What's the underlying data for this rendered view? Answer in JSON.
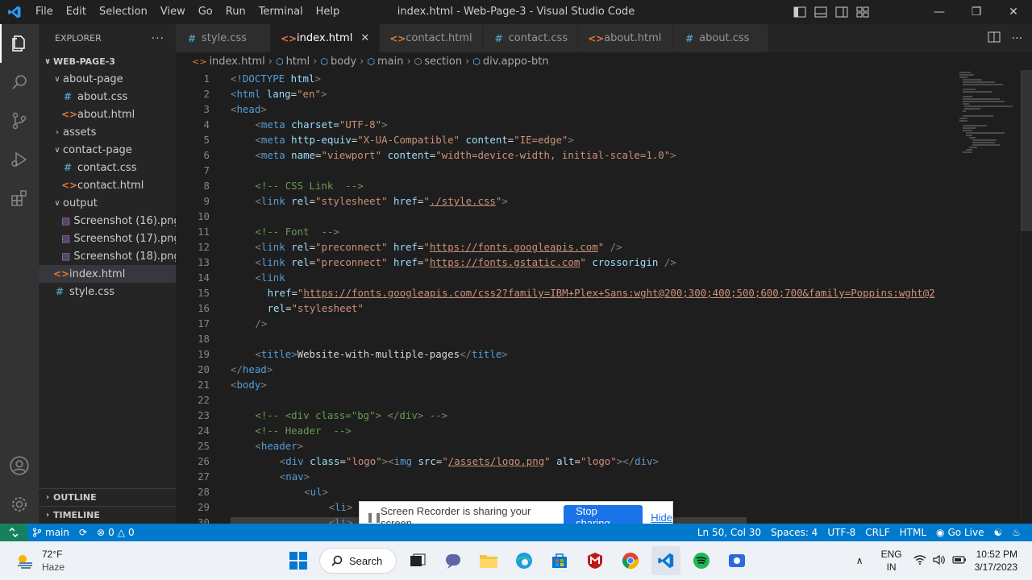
{
  "window": {
    "title": "index.html - Web-Page-3 - Visual Studio Code",
    "menu": [
      "File",
      "Edit",
      "Selection",
      "View",
      "Go",
      "Run",
      "Terminal",
      "Help"
    ]
  },
  "sidebar": {
    "header": "EXPLORER",
    "root": "WEB-PAGE-3",
    "tree": [
      {
        "label": "about-page",
        "type": "folder",
        "open": true,
        "depth": 1
      },
      {
        "label": "about.css",
        "type": "css",
        "depth": 2
      },
      {
        "label": "about.html",
        "type": "html",
        "depth": 2
      },
      {
        "label": "assets",
        "type": "folder",
        "open": false,
        "depth": 1
      },
      {
        "label": "contact-page",
        "type": "folder",
        "open": true,
        "depth": 1
      },
      {
        "label": "contact.css",
        "type": "css",
        "depth": 2
      },
      {
        "label": "contact.html",
        "type": "html",
        "depth": 2
      },
      {
        "label": "output",
        "type": "folder",
        "open": true,
        "depth": 1
      },
      {
        "label": "Screenshot (16).png",
        "type": "png",
        "depth": 2
      },
      {
        "label": "Screenshot (17).png",
        "type": "png",
        "depth": 2
      },
      {
        "label": "Screenshot (18).png",
        "type": "png",
        "depth": 2
      },
      {
        "label": "index.html",
        "type": "html",
        "depth": 1,
        "selected": true
      },
      {
        "label": "style.css",
        "type": "css",
        "depth": 1
      }
    ],
    "outline": "OUTLINE",
    "timeline": "TIMELINE"
  },
  "tabs": [
    {
      "label": "style.css",
      "type": "css",
      "active": false
    },
    {
      "label": "index.html",
      "type": "html",
      "active": true
    },
    {
      "label": "contact.html",
      "type": "html",
      "active": false
    },
    {
      "label": "contact.css",
      "type": "css",
      "active": false
    },
    {
      "label": "about.html",
      "type": "html",
      "active": false
    },
    {
      "label": "about.css",
      "type": "css",
      "active": false
    }
  ],
  "breadcrumb": [
    "index.html",
    "html",
    "body",
    "main",
    "section",
    "div.appo-btn"
  ],
  "code_lines": [
    {
      "n": "1",
      "indent": 0,
      "tokens": [
        [
          "br",
          "<!"
        ],
        [
          "tag",
          "DOCTYPE"
        ],
        [
          "text",
          " "
        ],
        [
          "attr",
          "html"
        ],
        [
          "br",
          ">"
        ]
      ]
    },
    {
      "n": "2",
      "indent": 0,
      "tokens": [
        [
          "br",
          "<"
        ],
        [
          "tag",
          "html"
        ],
        [
          "text",
          " "
        ],
        [
          "attr",
          "lang"
        ],
        [
          "text",
          "="
        ],
        [
          "str",
          "\"en\""
        ],
        [
          "br",
          ">"
        ]
      ]
    },
    {
      "n": "3",
      "indent": 0,
      "tokens": [
        [
          "br",
          "<"
        ],
        [
          "tag",
          "head"
        ],
        [
          "br",
          ">"
        ]
      ]
    },
    {
      "n": "4",
      "indent": 4,
      "tokens": [
        [
          "br",
          "<"
        ],
        [
          "tag",
          "meta"
        ],
        [
          "text",
          " "
        ],
        [
          "attr",
          "charset"
        ],
        [
          "text",
          "="
        ],
        [
          "str",
          "\"UTF-8\""
        ],
        [
          "br",
          ">"
        ]
      ]
    },
    {
      "n": "5",
      "indent": 4,
      "tokens": [
        [
          "br",
          "<"
        ],
        [
          "tag",
          "meta"
        ],
        [
          "text",
          " "
        ],
        [
          "attr",
          "http-equiv"
        ],
        [
          "text",
          "="
        ],
        [
          "str",
          "\"X-UA-Compatible\""
        ],
        [
          "text",
          " "
        ],
        [
          "attr",
          "content"
        ],
        [
          "text",
          "="
        ],
        [
          "str",
          "\"IE=edge\""
        ],
        [
          "br",
          ">"
        ]
      ]
    },
    {
      "n": "6",
      "indent": 4,
      "tokens": [
        [
          "br",
          "<"
        ],
        [
          "tag",
          "meta"
        ],
        [
          "text",
          " "
        ],
        [
          "attr",
          "name"
        ],
        [
          "text",
          "="
        ],
        [
          "str",
          "\"viewport\""
        ],
        [
          "text",
          " "
        ],
        [
          "attr",
          "content"
        ],
        [
          "text",
          "="
        ],
        [
          "str",
          "\"width=device-width, initial-scale=1.0\""
        ],
        [
          "br",
          ">"
        ]
      ]
    },
    {
      "n": "7",
      "indent": 0,
      "tokens": []
    },
    {
      "n": "8",
      "indent": 4,
      "tokens": [
        [
          "com",
          "<!-- CSS Link  -->"
        ]
      ]
    },
    {
      "n": "9",
      "indent": 4,
      "tokens": [
        [
          "br",
          "<"
        ],
        [
          "tag",
          "link"
        ],
        [
          "text",
          " "
        ],
        [
          "attr",
          "rel"
        ],
        [
          "text",
          "="
        ],
        [
          "str",
          "\"stylesheet\""
        ],
        [
          "text",
          " "
        ],
        [
          "attr",
          "href"
        ],
        [
          "text",
          "="
        ],
        [
          "str",
          "\""
        ],
        [
          "link",
          "./style.css"
        ],
        [
          "str",
          "\""
        ],
        [
          "br",
          ">"
        ]
      ]
    },
    {
      "n": "10",
      "indent": 0,
      "tokens": []
    },
    {
      "n": "11",
      "indent": 4,
      "tokens": [
        [
          "com",
          "<!-- Font  -->"
        ]
      ]
    },
    {
      "n": "12",
      "indent": 4,
      "tokens": [
        [
          "br",
          "<"
        ],
        [
          "tag",
          "link"
        ],
        [
          "text",
          " "
        ],
        [
          "attr",
          "rel"
        ],
        [
          "text",
          "="
        ],
        [
          "str",
          "\"preconnect\""
        ],
        [
          "text",
          " "
        ],
        [
          "attr",
          "href"
        ],
        [
          "text",
          "="
        ],
        [
          "str",
          "\""
        ],
        [
          "link",
          "https://fonts.googleapis.com"
        ],
        [
          "str",
          "\""
        ],
        [
          "text",
          " "
        ],
        [
          "br",
          "/>"
        ]
      ]
    },
    {
      "n": "13",
      "indent": 4,
      "tokens": [
        [
          "br",
          "<"
        ],
        [
          "tag",
          "link"
        ],
        [
          "text",
          " "
        ],
        [
          "attr",
          "rel"
        ],
        [
          "text",
          "="
        ],
        [
          "str",
          "\"preconnect\""
        ],
        [
          "text",
          " "
        ],
        [
          "attr",
          "href"
        ],
        [
          "text",
          "="
        ],
        [
          "str",
          "\""
        ],
        [
          "link",
          "https://fonts.gstatic.com"
        ],
        [
          "str",
          "\""
        ],
        [
          "text",
          " "
        ],
        [
          "attr",
          "crossorigin"
        ],
        [
          "text",
          " "
        ],
        [
          "br",
          "/>"
        ]
      ]
    },
    {
      "n": "14",
      "indent": 4,
      "tokens": [
        [
          "br",
          "<"
        ],
        [
          "tag",
          "link"
        ]
      ]
    },
    {
      "n": "15",
      "indent": 6,
      "tokens": [
        [
          "attr",
          "href"
        ],
        [
          "text",
          "="
        ],
        [
          "str",
          "\""
        ],
        [
          "link",
          "https://fonts.googleapis.com/css2?family=IBM+Plex+Sans:wght@200;300;400;500;600;700&family=Poppins:wght@2"
        ]
      ]
    },
    {
      "n": "16",
      "indent": 6,
      "tokens": [
        [
          "attr",
          "rel"
        ],
        [
          "text",
          "="
        ],
        [
          "str",
          "\"stylesheet\""
        ]
      ]
    },
    {
      "n": "17",
      "indent": 4,
      "tokens": [
        [
          "br",
          "/>"
        ]
      ]
    },
    {
      "n": "18",
      "indent": 0,
      "tokens": []
    },
    {
      "n": "19",
      "indent": 4,
      "tokens": [
        [
          "br",
          "<"
        ],
        [
          "tag",
          "title"
        ],
        [
          "br",
          ">"
        ],
        [
          "text",
          "Website-with-multiple-pages"
        ],
        [
          "br",
          "</"
        ],
        [
          "tag",
          "title"
        ],
        [
          "br",
          ">"
        ]
      ]
    },
    {
      "n": "20",
      "indent": 0,
      "tokens": [
        [
          "br",
          "</"
        ],
        [
          "tag",
          "head"
        ],
        [
          "br",
          ">"
        ]
      ]
    },
    {
      "n": "21",
      "indent": 0,
      "tokens": [
        [
          "br",
          "<"
        ],
        [
          "tag",
          "body"
        ],
        [
          "br",
          ">"
        ]
      ]
    },
    {
      "n": "22",
      "indent": 0,
      "tokens": []
    },
    {
      "n": "23",
      "indent": 4,
      "tokens": [
        [
          "com",
          "<!-- <div class=\"bg\"> </div> -->"
        ]
      ]
    },
    {
      "n": "24",
      "indent": 4,
      "tokens": [
        [
          "com",
          "<!-- Header  -->"
        ]
      ]
    },
    {
      "n": "25",
      "indent": 4,
      "tokens": [
        [
          "br",
          "<"
        ],
        [
          "tag",
          "header"
        ],
        [
          "br",
          ">"
        ]
      ]
    },
    {
      "n": "26",
      "indent": 8,
      "tokens": [
        [
          "br",
          "<"
        ],
        [
          "tag",
          "div"
        ],
        [
          "text",
          " "
        ],
        [
          "attr",
          "class"
        ],
        [
          "text",
          "="
        ],
        [
          "str",
          "\"logo\""
        ],
        [
          "br",
          ">"
        ],
        [
          "br",
          "<"
        ],
        [
          "tag",
          "img"
        ],
        [
          "text",
          " "
        ],
        [
          "attr",
          "src"
        ],
        [
          "text",
          "="
        ],
        [
          "str",
          "\""
        ],
        [
          "link",
          "/assets/logo.png"
        ],
        [
          "str",
          "\""
        ],
        [
          "text",
          " "
        ],
        [
          "attr",
          "alt"
        ],
        [
          "text",
          "="
        ],
        [
          "str",
          "\"logo\""
        ],
        [
          "br",
          ">"
        ],
        [
          "br",
          "</"
        ],
        [
          "tag",
          "div"
        ],
        [
          "br",
          ">"
        ]
      ]
    },
    {
      "n": "27",
      "indent": 8,
      "tokens": [
        [
          "br",
          "<"
        ],
        [
          "tag",
          "nav"
        ],
        [
          "br",
          ">"
        ]
      ]
    },
    {
      "n": "28",
      "indent": 12,
      "tokens": [
        [
          "br",
          "<"
        ],
        [
          "tag",
          "ul"
        ],
        [
          "br",
          ">"
        ]
      ]
    },
    {
      "n": "29",
      "indent": 16,
      "tokens": [
        [
          "br",
          "<"
        ],
        [
          "tag",
          "li"
        ],
        [
          "br",
          ">"
        ]
      ]
    },
    {
      "n": "30",
      "indent": 16,
      "tokens": [
        [
          "br",
          "<"
        ],
        [
          "tag",
          "li"
        ],
        [
          "br",
          ">"
        ]
      ]
    }
  ],
  "notification": {
    "text": "Screen Recorder is sharing your screen.",
    "stop": "Stop sharing",
    "hide": "Hide"
  },
  "statusbar": {
    "branch": "main",
    "errors": "0",
    "warnings": "0",
    "position": "Ln 50, Col 30",
    "spaces": "Spaces: 4",
    "encoding": "UTF-8",
    "eol": "CRLF",
    "language": "HTML",
    "golive": "Go Live"
  },
  "taskbar": {
    "temp": "72°F",
    "weather": "Haze",
    "search": "Search",
    "lang1": "ENG",
    "lang2": "IN",
    "time": "10:52 PM",
    "date": "3/17/2023"
  },
  "colors": {
    "accent": "#007acc",
    "tag": "#569cd6",
    "attr": "#9cdcfe",
    "string": "#ce9178",
    "comment": "#6a9955"
  }
}
